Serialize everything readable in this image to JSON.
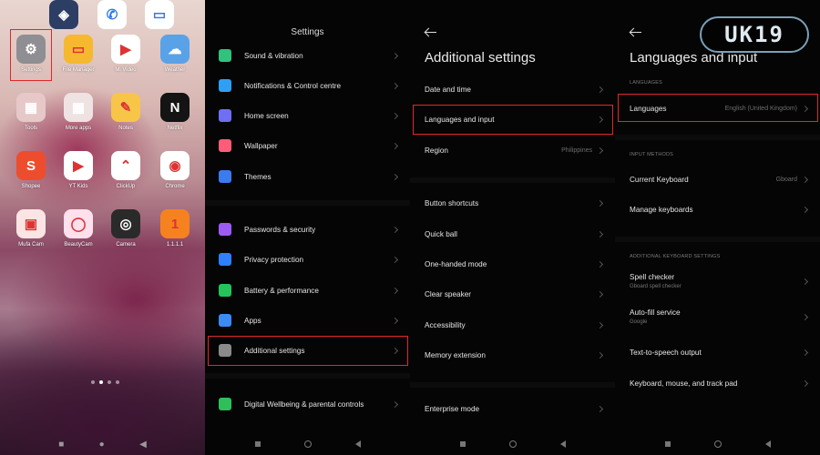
{
  "home": {
    "apps": [
      {
        "label": "Settings",
        "icon": "settings-icon",
        "color": "#8e8e93",
        "glyph": "⚙"
      },
      {
        "label": "File Manager",
        "icon": "folder-icon",
        "color": "#f5b82e",
        "glyph": "▭"
      },
      {
        "label": "Mi Video",
        "icon": "play-icon",
        "color": "#ffffff",
        "glyph": "▶"
      },
      {
        "label": "Weather",
        "icon": "weather-icon",
        "color": "#5aa2e8",
        "glyph": "☁"
      },
      {
        "label": "Tools",
        "icon": "tools-folder-icon",
        "color": "#e7c8c8",
        "glyph": "▦"
      },
      {
        "label": "More apps",
        "icon": "more-apps-folder-icon",
        "color": "#efe2e2",
        "glyph": "▦"
      },
      {
        "label": "Notes",
        "icon": "notes-icon",
        "color": "#f7c548",
        "glyph": "✎"
      },
      {
        "label": "Netflix",
        "icon": "netflix-icon",
        "color": "#141414",
        "glyph": "N"
      },
      {
        "label": "Shopee",
        "icon": "shopee-icon",
        "color": "#ee4d2d",
        "glyph": "S"
      },
      {
        "label": "YT Kids",
        "icon": "yt-kids-icon",
        "color": "#ffffff",
        "glyph": "▶"
      },
      {
        "label": "ClickUp",
        "icon": "clickup-icon",
        "color": "#ffffff",
        "glyph": "⌃"
      },
      {
        "label": "Chrome",
        "icon": "chrome-icon",
        "color": "#ffffff",
        "glyph": "◉"
      },
      {
        "label": "Mufa Cam",
        "icon": "camera-app-icon",
        "color": "#fbe4e4",
        "glyph": "▣"
      },
      {
        "label": "BeautyCam",
        "icon": "beautycam-icon",
        "color": "#ffe0ec",
        "glyph": "◯"
      },
      {
        "label": "Camera",
        "icon": "camera-icon",
        "color": "#2a2a2a",
        "glyph": "◎"
      },
      {
        "label": "1.1.1.1",
        "icon": "cloudflare-icon",
        "color": "#f6821f",
        "glyph": "1"
      }
    ],
    "dock": [
      {
        "icon": "game-icon",
        "color": "#2c3e63",
        "glyph": "◈"
      },
      {
        "icon": "phone-icon",
        "color": "#ffffff",
        "glyph": "✆"
      },
      {
        "icon": "messages-icon",
        "color": "#ffffff",
        "glyph": "▭"
      }
    ]
  },
  "settings": {
    "title": "Settings",
    "items": [
      {
        "label": "Sound & vibration",
        "icon": "sound-icon",
        "color": "#31c27c"
      },
      {
        "label": "Notifications & Control centre",
        "icon": "notification-icon",
        "color": "#2f9ff5"
      },
      {
        "label": "Home screen",
        "icon": "home-icon",
        "color": "#6f6ff5"
      },
      {
        "label": "Wallpaper",
        "icon": "wallpaper-icon",
        "color": "#ff5c7a"
      },
      {
        "label": "Themes",
        "icon": "themes-icon",
        "color": "#3a7bf2"
      },
      {
        "label": "Passwords & security",
        "icon": "security-icon",
        "color": "#9b5cf5"
      },
      {
        "label": "Privacy protection",
        "icon": "privacy-icon",
        "color": "#2f80ff"
      },
      {
        "label": "Battery & performance",
        "icon": "battery-icon",
        "color": "#24c45b"
      },
      {
        "label": "Apps",
        "icon": "apps-icon",
        "color": "#3a8bf5"
      },
      {
        "label": "Additional settings",
        "icon": "more-icon",
        "color": "#8a8a8a"
      },
      {
        "label": "Digital Wellbeing & parental controls",
        "icon": "wellbeing-icon",
        "color": "#2fbf5a"
      }
    ]
  },
  "additional": {
    "title": "Additional settings",
    "items": [
      {
        "label": "Date and time",
        "value": ""
      },
      {
        "label": "Languages and input",
        "value": ""
      },
      {
        "label": "Region",
        "value": "Philippines"
      },
      {
        "label": "Button shortcuts",
        "value": ""
      },
      {
        "label": "Quick ball",
        "value": ""
      },
      {
        "label": "One-handed mode",
        "value": ""
      },
      {
        "label": "Clear speaker",
        "value": ""
      },
      {
        "label": "Accessibility",
        "value": ""
      },
      {
        "label": "Memory extension",
        "value": ""
      },
      {
        "label": "Enterprise mode",
        "value": ""
      }
    ]
  },
  "languages": {
    "title": "Languages and input",
    "section_languages": "LANGUAGES",
    "section_input": "INPUT METHODS",
    "section_additional": "ADDITIONAL KEYBOARD SETTINGS",
    "items": [
      {
        "label": "Languages",
        "value": "English (United Kingdom)",
        "sub": ""
      },
      {
        "label": "Current Keyboard",
        "value": "Gboard",
        "sub": ""
      },
      {
        "label": "Manage keyboards",
        "value": "",
        "sub": ""
      },
      {
        "label": "Spell checker",
        "value": "",
        "sub": "Gboard spell checker"
      },
      {
        "label": "Auto-fill service",
        "value": "",
        "sub": "Google"
      },
      {
        "label": "Text-to-speech output",
        "value": "",
        "sub": ""
      },
      {
        "label": "Keyboard, mouse, and track pad",
        "value": "",
        "sub": ""
      }
    ]
  },
  "watermark": "UK19",
  "colors": {
    "highlight": "#e0282b",
    "background": "#050505"
  }
}
